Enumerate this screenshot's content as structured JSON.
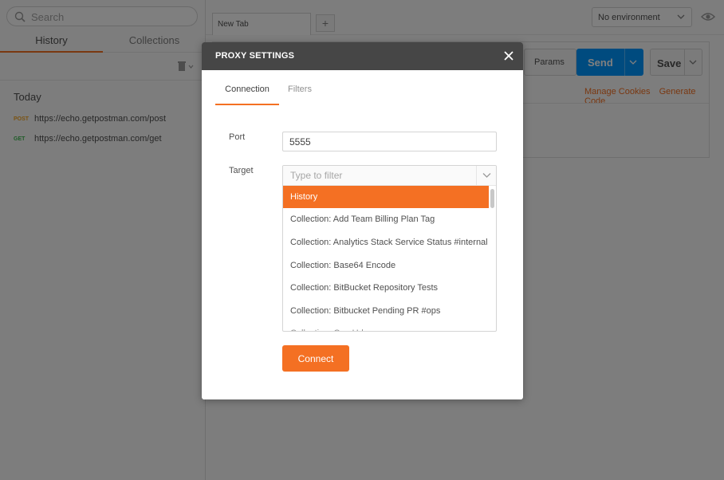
{
  "sidebar": {
    "search_placeholder": "Search",
    "tabs": [
      {
        "label": "History",
        "active": true
      },
      {
        "label": "Collections",
        "active": false
      }
    ],
    "group_label": "Today",
    "history": [
      {
        "method": "POST",
        "url": "https://echo.getpostman.com/post"
      },
      {
        "method": "GET",
        "url": "https://echo.getpostman.com/get"
      }
    ]
  },
  "main": {
    "tab_label": "New Tab",
    "add_tab_label": "+",
    "environment": "No environment",
    "params_label": "Params",
    "send_label": "Send",
    "save_label": "Save",
    "manage_cookies": "Manage Cookies",
    "generate_code": "Generate Code"
  },
  "modal": {
    "title": "PROXY SETTINGS",
    "tabs": [
      {
        "label": "Connection",
        "active": true
      },
      {
        "label": "Filters",
        "active": false
      }
    ],
    "port_label": "Port",
    "port_value": "5555",
    "target_label": "Target",
    "target_placeholder": "Type to filter",
    "target_options": [
      "History",
      "Collection: Add Team Billing Plan Tag",
      "Collection: Analytics Stack Service Status #internal",
      "Collection: Base64 Encode",
      "Collection: BitBucket Repository Tests",
      "Collection: Bitbucket Pending PR #ops",
      "Collection: Cap Udon"
    ],
    "selected_option": "History",
    "connect_label": "Connect"
  },
  "colors": {
    "accent": "#f47023",
    "send": "#0096ff",
    "modal_header": "#464646",
    "overlay": "rgba(0,0,0,0.5)"
  },
  "icons": {
    "search": "search-icon",
    "trash": "trash-icon",
    "close": "close-icon",
    "chevron": "chevron-down-icon",
    "eye": "eye-icon"
  }
}
